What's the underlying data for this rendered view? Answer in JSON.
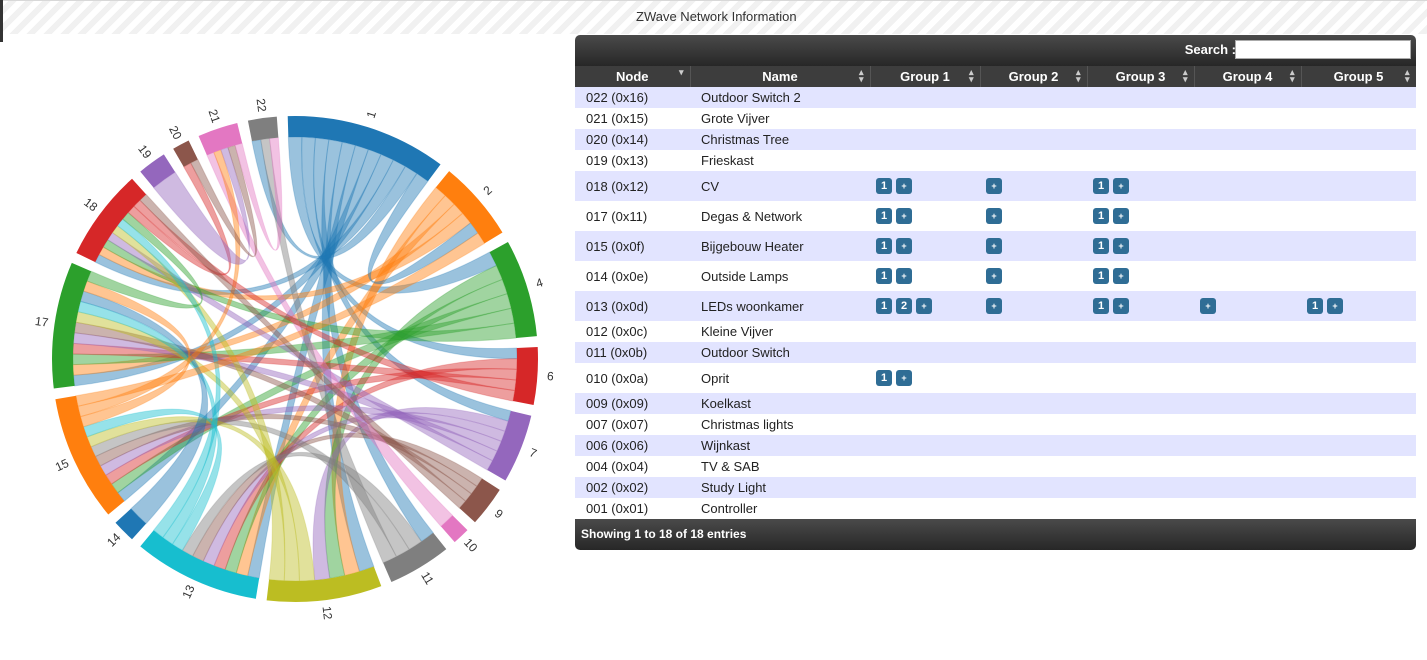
{
  "page": {
    "title": "ZWave Network Information"
  },
  "search": {
    "label": "Search :",
    "value": ""
  },
  "table": {
    "columns": [
      {
        "label": "Node",
        "sort": "desc"
      },
      {
        "label": "Name",
        "sort": "both"
      },
      {
        "label": "Group 1",
        "sort": "both"
      },
      {
        "label": "Group 2",
        "sort": "both"
      },
      {
        "label": "Group 3",
        "sort": "both"
      },
      {
        "label": "Group 4",
        "sort": "both"
      },
      {
        "label": "Group 5",
        "sort": "both"
      }
    ],
    "rows": [
      {
        "node": "022 (0x16)",
        "name": "Outdoor Switch 2",
        "groups": [
          null,
          null,
          null,
          null,
          null
        ]
      },
      {
        "node": "021 (0x15)",
        "name": "Grote Vijver",
        "groups": [
          null,
          null,
          null,
          null,
          null
        ]
      },
      {
        "node": "020 (0x14)",
        "name": "Christmas Tree",
        "groups": [
          null,
          null,
          null,
          null,
          null
        ]
      },
      {
        "node": "019 (0x13)",
        "name": "Frieskast",
        "groups": [
          null,
          null,
          null,
          null,
          null
        ]
      },
      {
        "node": "018 (0x12)",
        "name": "CV",
        "groups": [
          [
            "1",
            "+"
          ],
          [
            "+"
          ],
          [
            "1",
            "+"
          ],
          null,
          null
        ]
      },
      {
        "node": "017 (0x11)",
        "name": "Degas & Network",
        "groups": [
          [
            "1",
            "+"
          ],
          [
            "+"
          ],
          [
            "1",
            "+"
          ],
          null,
          null
        ]
      },
      {
        "node": "015 (0x0f)",
        "name": "Bijgebouw Heater",
        "groups": [
          [
            "1",
            "+"
          ],
          [
            "+"
          ],
          [
            "1",
            "+"
          ],
          null,
          null
        ]
      },
      {
        "node": "014 (0x0e)",
        "name": "Outside Lamps",
        "groups": [
          [
            "1",
            "+"
          ],
          [
            "+"
          ],
          [
            "1",
            "+"
          ],
          null,
          null
        ]
      },
      {
        "node": "013 (0x0d)",
        "name": "LEDs woonkamer",
        "groups": [
          [
            "1",
            "2",
            "+"
          ],
          [
            "+"
          ],
          [
            "1",
            "+"
          ],
          [
            "+"
          ],
          [
            "1",
            "+"
          ]
        ]
      },
      {
        "node": "012 (0x0c)",
        "name": "Kleine Vijver",
        "groups": [
          null,
          null,
          null,
          null,
          null
        ]
      },
      {
        "node": "011 (0x0b)",
        "name": "Outdoor Switch",
        "groups": [
          null,
          null,
          null,
          null,
          null
        ]
      },
      {
        "node": "010 (0x0a)",
        "name": "Oprit",
        "groups": [
          [
            "1",
            "+"
          ],
          null,
          null,
          null,
          null
        ]
      },
      {
        "node": "009 (0x09)",
        "name": "Koelkast",
        "groups": [
          null,
          null,
          null,
          null,
          null
        ]
      },
      {
        "node": "007 (0x07)",
        "name": "Christmas lights",
        "groups": [
          null,
          null,
          null,
          null,
          null
        ]
      },
      {
        "node": "006 (0x06)",
        "name": "Wijnkast",
        "groups": [
          null,
          null,
          null,
          null,
          null
        ]
      },
      {
        "node": "004 (0x04)",
        "name": "TV & SAB",
        "groups": [
          null,
          null,
          null,
          null,
          null
        ]
      },
      {
        "node": "002 (0x02)",
        "name": "Study Light",
        "groups": [
          null,
          null,
          null,
          null,
          null
        ]
      },
      {
        "node": "001 (0x01)",
        "name": "Controller",
        "groups": [
          null,
          null,
          null,
          null,
          null
        ]
      }
    ],
    "footer": "Showing 1 to 18 of 18 entries"
  },
  "chord": {
    "segments": [
      {
        "label": "1",
        "weight": 14,
        "color": "#1f77b4"
      },
      {
        "label": "2",
        "weight": 7,
        "color": "#ff7f0e"
      },
      {
        "label": "4",
        "weight": 8.5,
        "color": "#2ca02c"
      },
      {
        "label": "6",
        "weight": 5,
        "color": "#d62728"
      },
      {
        "label": "7",
        "weight": 6,
        "color": "#9467bd"
      },
      {
        "label": "9",
        "weight": 3.5,
        "color": "#8c564b"
      },
      {
        "label": "10",
        "weight": 1.5,
        "color": "#e377c2"
      },
      {
        "label": "11",
        "weight": 5.5,
        "color": "#7f7f7f"
      },
      {
        "label": "12",
        "weight": 10,
        "color": "#bcbd22"
      },
      {
        "label": "13",
        "weight": 11,
        "color": "#17becf"
      },
      {
        "label": "14",
        "weight": 2,
        "color": "#1f77b4"
      },
      {
        "label": "15",
        "weight": 11,
        "color": "#ff7f0e"
      },
      {
        "label": "17",
        "weight": 11,
        "color": "#2ca02c"
      },
      {
        "label": "18",
        "weight": 8,
        "color": "#d62728"
      },
      {
        "label": "19",
        "weight": 2.5,
        "color": "#9467bd"
      },
      {
        "label": "20",
        "weight": 1.5,
        "color": "#8c564b"
      },
      {
        "label": "21",
        "weight": 3.5,
        "color": "#e377c2"
      },
      {
        "label": "22",
        "weight": 2.5,
        "color": "#7f7f7f"
      }
    ],
    "links": [
      [
        0,
        2
      ],
      [
        0,
        3
      ],
      [
        0,
        4
      ],
      [
        0,
        7
      ],
      [
        0,
        8
      ],
      [
        0,
        9
      ],
      [
        0,
        11
      ],
      [
        0,
        12
      ],
      [
        0,
        13
      ],
      [
        0,
        17
      ],
      [
        1,
        8
      ],
      [
        1,
        9
      ],
      [
        1,
        12
      ],
      [
        1,
        13
      ],
      [
        2,
        8
      ],
      [
        2,
        9
      ],
      [
        2,
        11
      ],
      [
        2,
        12
      ],
      [
        2,
        13
      ],
      [
        3,
        9
      ],
      [
        3,
        11
      ],
      [
        3,
        12
      ],
      [
        4,
        8
      ],
      [
        4,
        9
      ],
      [
        4,
        11
      ],
      [
        4,
        12
      ],
      [
        4,
        13
      ],
      [
        5,
        9
      ],
      [
        5,
        11
      ],
      [
        5,
        12
      ],
      [
        6,
        16
      ],
      [
        7,
        9
      ],
      [
        7,
        11
      ],
      [
        7,
        17
      ],
      [
        8,
        11
      ],
      [
        8,
        12
      ],
      [
        8,
        13
      ],
      [
        9,
        11
      ],
      [
        9,
        12
      ],
      [
        9,
        13
      ],
      [
        10,
        12
      ],
      [
        11,
        12
      ],
      [
        11,
        16
      ],
      [
        12,
        13
      ],
      [
        13,
        15
      ],
      [
        14,
        16
      ],
      [
        15,
        16
      ],
      [
        16,
        17
      ],
      [
        0,
        1
      ],
      [
        1,
        11
      ],
      [
        3,
        13
      ],
      [
        5,
        13
      ]
    ]
  }
}
